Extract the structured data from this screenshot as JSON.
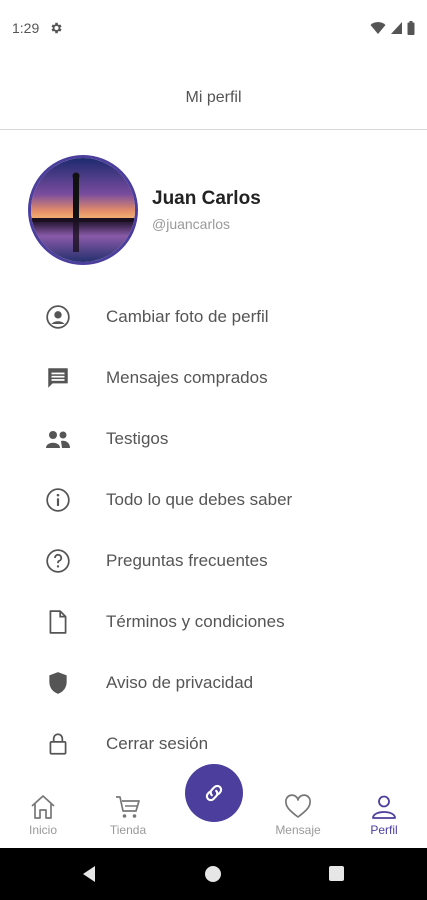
{
  "status": {
    "time": "1:29"
  },
  "header": {
    "title": "Mi perfil"
  },
  "profile": {
    "name": "Juan Carlos",
    "handle": "@juancarlos"
  },
  "menu": [
    {
      "label": "Cambiar foto de perfil",
      "icon": "account-circle-icon"
    },
    {
      "label": "Mensajes comprados",
      "icon": "message-icon"
    },
    {
      "label": "Testigos",
      "icon": "people-icon"
    },
    {
      "label": "Todo lo que debes saber",
      "icon": "info-icon"
    },
    {
      "label": "Preguntas frecuentes",
      "icon": "help-icon"
    },
    {
      "label": "Términos y condiciones",
      "icon": "document-icon"
    },
    {
      "label": "Aviso de privacidad",
      "icon": "shield-icon"
    },
    {
      "label": "Cerrar sesión",
      "icon": "lock-icon"
    }
  ],
  "nav": {
    "inicio": "Inicio",
    "tienda": "Tienda",
    "mensaje": "Mensaje",
    "perfil": "Perfil",
    "active": "perfil"
  },
  "colors": {
    "accent": "#4b3e9c",
    "icon": "#555555"
  }
}
